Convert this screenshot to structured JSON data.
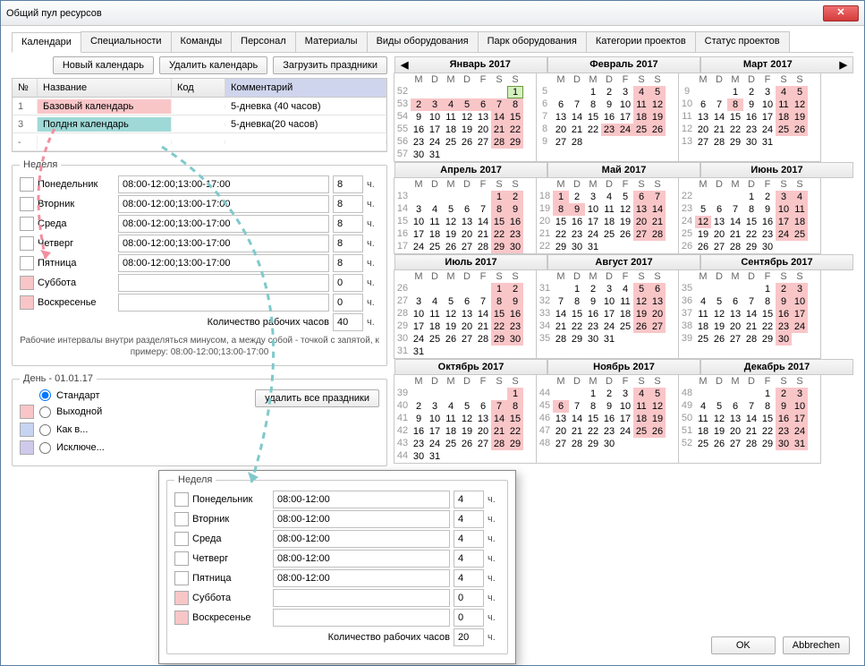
{
  "window": {
    "title": "Общий пул ресурсов"
  },
  "tabs": [
    "Календари",
    "Специальности",
    "Команды",
    "Персонал",
    "Материалы",
    "Виды оборудования",
    "Парк оборудования",
    "Категории проектов",
    "Статус проектов"
  ],
  "toolbar": {
    "new": "Новый календарь",
    "delete": "Удалить календарь",
    "load": "Загрузить праздники"
  },
  "grid": {
    "headers": {
      "num": "№",
      "name": "Название",
      "code": "Код",
      "comment": "Комментарий"
    },
    "rows": [
      {
        "num": "1",
        "name": "Базовый календарь",
        "code": "",
        "comment": "5-дневка (40 часов)"
      },
      {
        "num": "3",
        "name": "Полдня календарь",
        "code": "",
        "comment": "5-дневка(20 часов)"
      },
      {
        "num": "-",
        "name": "",
        "code": "",
        "comment": ""
      }
    ]
  },
  "week1": {
    "legend": "Неделя",
    "days": [
      {
        "label": "Понедельник",
        "time": "08:00-12:00;13:00-17:00",
        "hours": "8"
      },
      {
        "label": "Вторник",
        "time": "08:00-12:00;13:00-17:00",
        "hours": "8"
      },
      {
        "label": "Среда",
        "time": "08:00-12:00;13:00-17:00",
        "hours": "8"
      },
      {
        "label": "Четверг",
        "time": "08:00-12:00;13:00-17:00",
        "hours": "8"
      },
      {
        "label": "Пятница",
        "time": "08:00-12:00;13:00-17:00",
        "hours": "8"
      },
      {
        "label": "Суббота",
        "time": "",
        "hours": "0"
      },
      {
        "label": "Воскресенье",
        "time": "",
        "hours": "0"
      }
    ],
    "total_label": "Количество рабочих часов",
    "total": "40",
    "unit": "ч.",
    "help": "Рабочие интервалы внутри разделяться минусом, а между собой - точкой с запятой, к примеру: 08:00-12:00;13:00-17:00"
  },
  "day_section": {
    "legend": "День - 01.01.17",
    "radios": {
      "standard": "Стандарт",
      "weekend": "Выходной",
      "likein": "Как в...",
      "exclude": "Исключе..."
    },
    "delete_holidays": "удалить все праздники"
  },
  "week2": {
    "legend": "Неделя",
    "days": [
      {
        "label": "Понедельник",
        "time": "08:00-12:00",
        "hours": "4"
      },
      {
        "label": "Вторник",
        "time": "08:00-12:00",
        "hours": "4"
      },
      {
        "label": "Среда",
        "time": "08:00-12:00",
        "hours": "4"
      },
      {
        "label": "Четверг",
        "time": "08:00-12:00",
        "hours": "4"
      },
      {
        "label": "Пятница",
        "time": "08:00-12:00",
        "hours": "4"
      },
      {
        "label": "Суббота",
        "time": "",
        "hours": "0"
      },
      {
        "label": "Воскресенье",
        "time": "",
        "hours": "0"
      }
    ],
    "total_label": "Количество рабочих часов",
    "total": "20",
    "unit": "ч."
  },
  "calendar": {
    "dow": [
      "M",
      "D",
      "M",
      "D",
      "F",
      "S",
      "S"
    ],
    "months": [
      "Январь 2017",
      "Февраль 2017",
      "Март 2017",
      "Апрель 2017",
      "Май 2017",
      "Июнь 2017",
      "Июль 2017",
      "Август 2017",
      "Сентябрь 2017",
      "Октябрь 2017",
      "Ноябрь 2017",
      "Декабрь 2017"
    ]
  },
  "footer": {
    "ok": "OK",
    "cancel": "Abbrechen"
  }
}
